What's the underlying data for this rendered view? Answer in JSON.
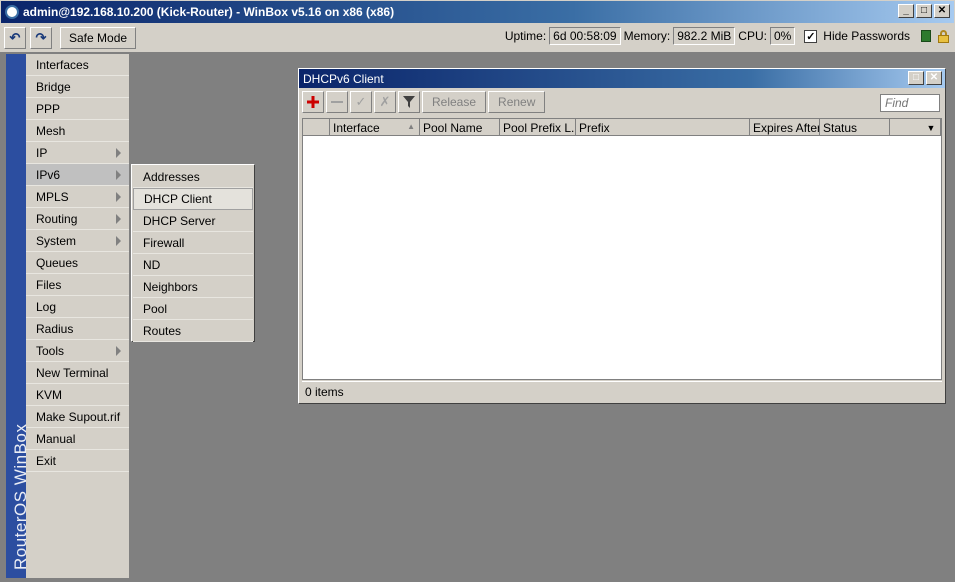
{
  "app": {
    "title": "admin@192.168.10.200 (Kick-Router) - WinBox v5.16 on x86 (x86)",
    "brand": "RouterOS WinBox"
  },
  "toolbar": {
    "undo_icon": "undo-icon",
    "redo_icon": "redo-icon",
    "safe_mode_label": "Safe Mode",
    "uptime_label": "Uptime:",
    "uptime_value": "6d 00:58:09",
    "memory_label": "Memory:",
    "memory_value": "982.2 MiB",
    "cpu_label": "CPU:",
    "cpu_value": "0%",
    "hide_passwords_label": "Hide Passwords",
    "hide_passwords_checked": true
  },
  "sidebar": {
    "items": [
      {
        "label": "Interfaces",
        "has_submenu": false
      },
      {
        "label": "Bridge",
        "has_submenu": false
      },
      {
        "label": "PPP",
        "has_submenu": false
      },
      {
        "label": "Mesh",
        "has_submenu": false
      },
      {
        "label": "IP",
        "has_submenu": true
      },
      {
        "label": "IPv6",
        "has_submenu": true
      },
      {
        "label": "MPLS",
        "has_submenu": true
      },
      {
        "label": "Routing",
        "has_submenu": true
      },
      {
        "label": "System",
        "has_submenu": true
      },
      {
        "label": "Queues",
        "has_submenu": false
      },
      {
        "label": "Files",
        "has_submenu": false
      },
      {
        "label": "Log",
        "has_submenu": false
      },
      {
        "label": "Radius",
        "has_submenu": false
      },
      {
        "label": "Tools",
        "has_submenu": true
      },
      {
        "label": "New Terminal",
        "has_submenu": false
      },
      {
        "label": "KVM",
        "has_submenu": false
      },
      {
        "label": "Make Supout.rif",
        "has_submenu": false
      },
      {
        "label": "Manual",
        "has_submenu": false
      },
      {
        "label": "Exit",
        "has_submenu": false
      }
    ]
  },
  "submenu": {
    "parent": "IPv6",
    "items": [
      "Addresses",
      "DHCP Client",
      "DHCP Server",
      "Firewall",
      "ND",
      "Neighbors",
      "Pool",
      "Routes"
    ],
    "selected": "DHCP Client"
  },
  "dhcp_window": {
    "title": "DHCPv6 Client",
    "buttons": {
      "add_icon": "plus-icon",
      "remove_icon": "minus-icon",
      "enable_icon": "check-icon",
      "disable_icon": "x-icon",
      "filter_icon": "filter-icon",
      "release_label": "Release",
      "renew_label": "Renew"
    },
    "find_placeholder": "Find",
    "columns": [
      "",
      "Interface",
      "Pool Name",
      "Pool Prefix L...",
      "Prefix",
      "Expires After",
      "Status"
    ],
    "rows": [],
    "status": "0 items"
  },
  "colors": {
    "title_bar": "#0a246a",
    "brand_strip": "#2c4ea0",
    "workspace": "#808080",
    "add_icon": "#cc0000"
  }
}
